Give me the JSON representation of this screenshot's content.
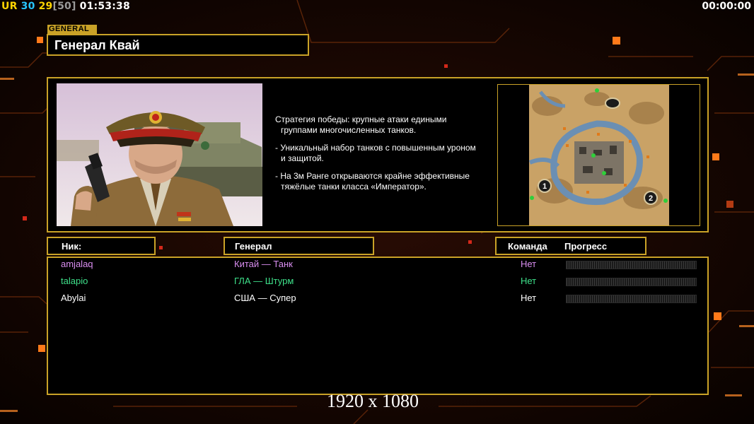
{
  "hud": {
    "tag": "UR",
    "players": "30",
    "fps": "29",
    "fps_limit": "[50]",
    "clock": "01:53:38",
    "timer": "00:00:00"
  },
  "general_tag": "GENERAL",
  "general_name": "Генерал Квай",
  "description": {
    "line1": "Стратегия победы: крупные атаки едиными",
    "line1b": "группами многочисленных танков.",
    "line2": "- Уникальный набор танков с повышенным уроном",
    "line2b": "и защитой.",
    "line3": "- На 3м Ранге открываются крайне эффективные",
    "line3b": "тяжёлые танки класса «Император»."
  },
  "map": {
    "spawn_1": "1",
    "spawn_2": "2"
  },
  "columns": {
    "nick": "Ник:",
    "general": "Генерал",
    "team": "Команда",
    "progress": "Прогресс"
  },
  "players": [
    {
      "nick": "amjalaq",
      "general": "Китай — Танк",
      "team": "Нет",
      "color": "#d98ef0",
      "progress": 0
    },
    {
      "nick": "talapio",
      "general": "ГЛА — Штурм",
      "team": "Нет",
      "color": "#3ee08a",
      "progress": 0
    },
    {
      "nick": "Abylai",
      "general": "США — Супер",
      "team": "Нет",
      "color": "#ffffff",
      "progress": 0
    }
  ],
  "resolution": "1920 x 1080",
  "colors": {
    "accent": "#c9a227",
    "panel_bg": "#000000",
    "glow": "#ff7a1a"
  }
}
